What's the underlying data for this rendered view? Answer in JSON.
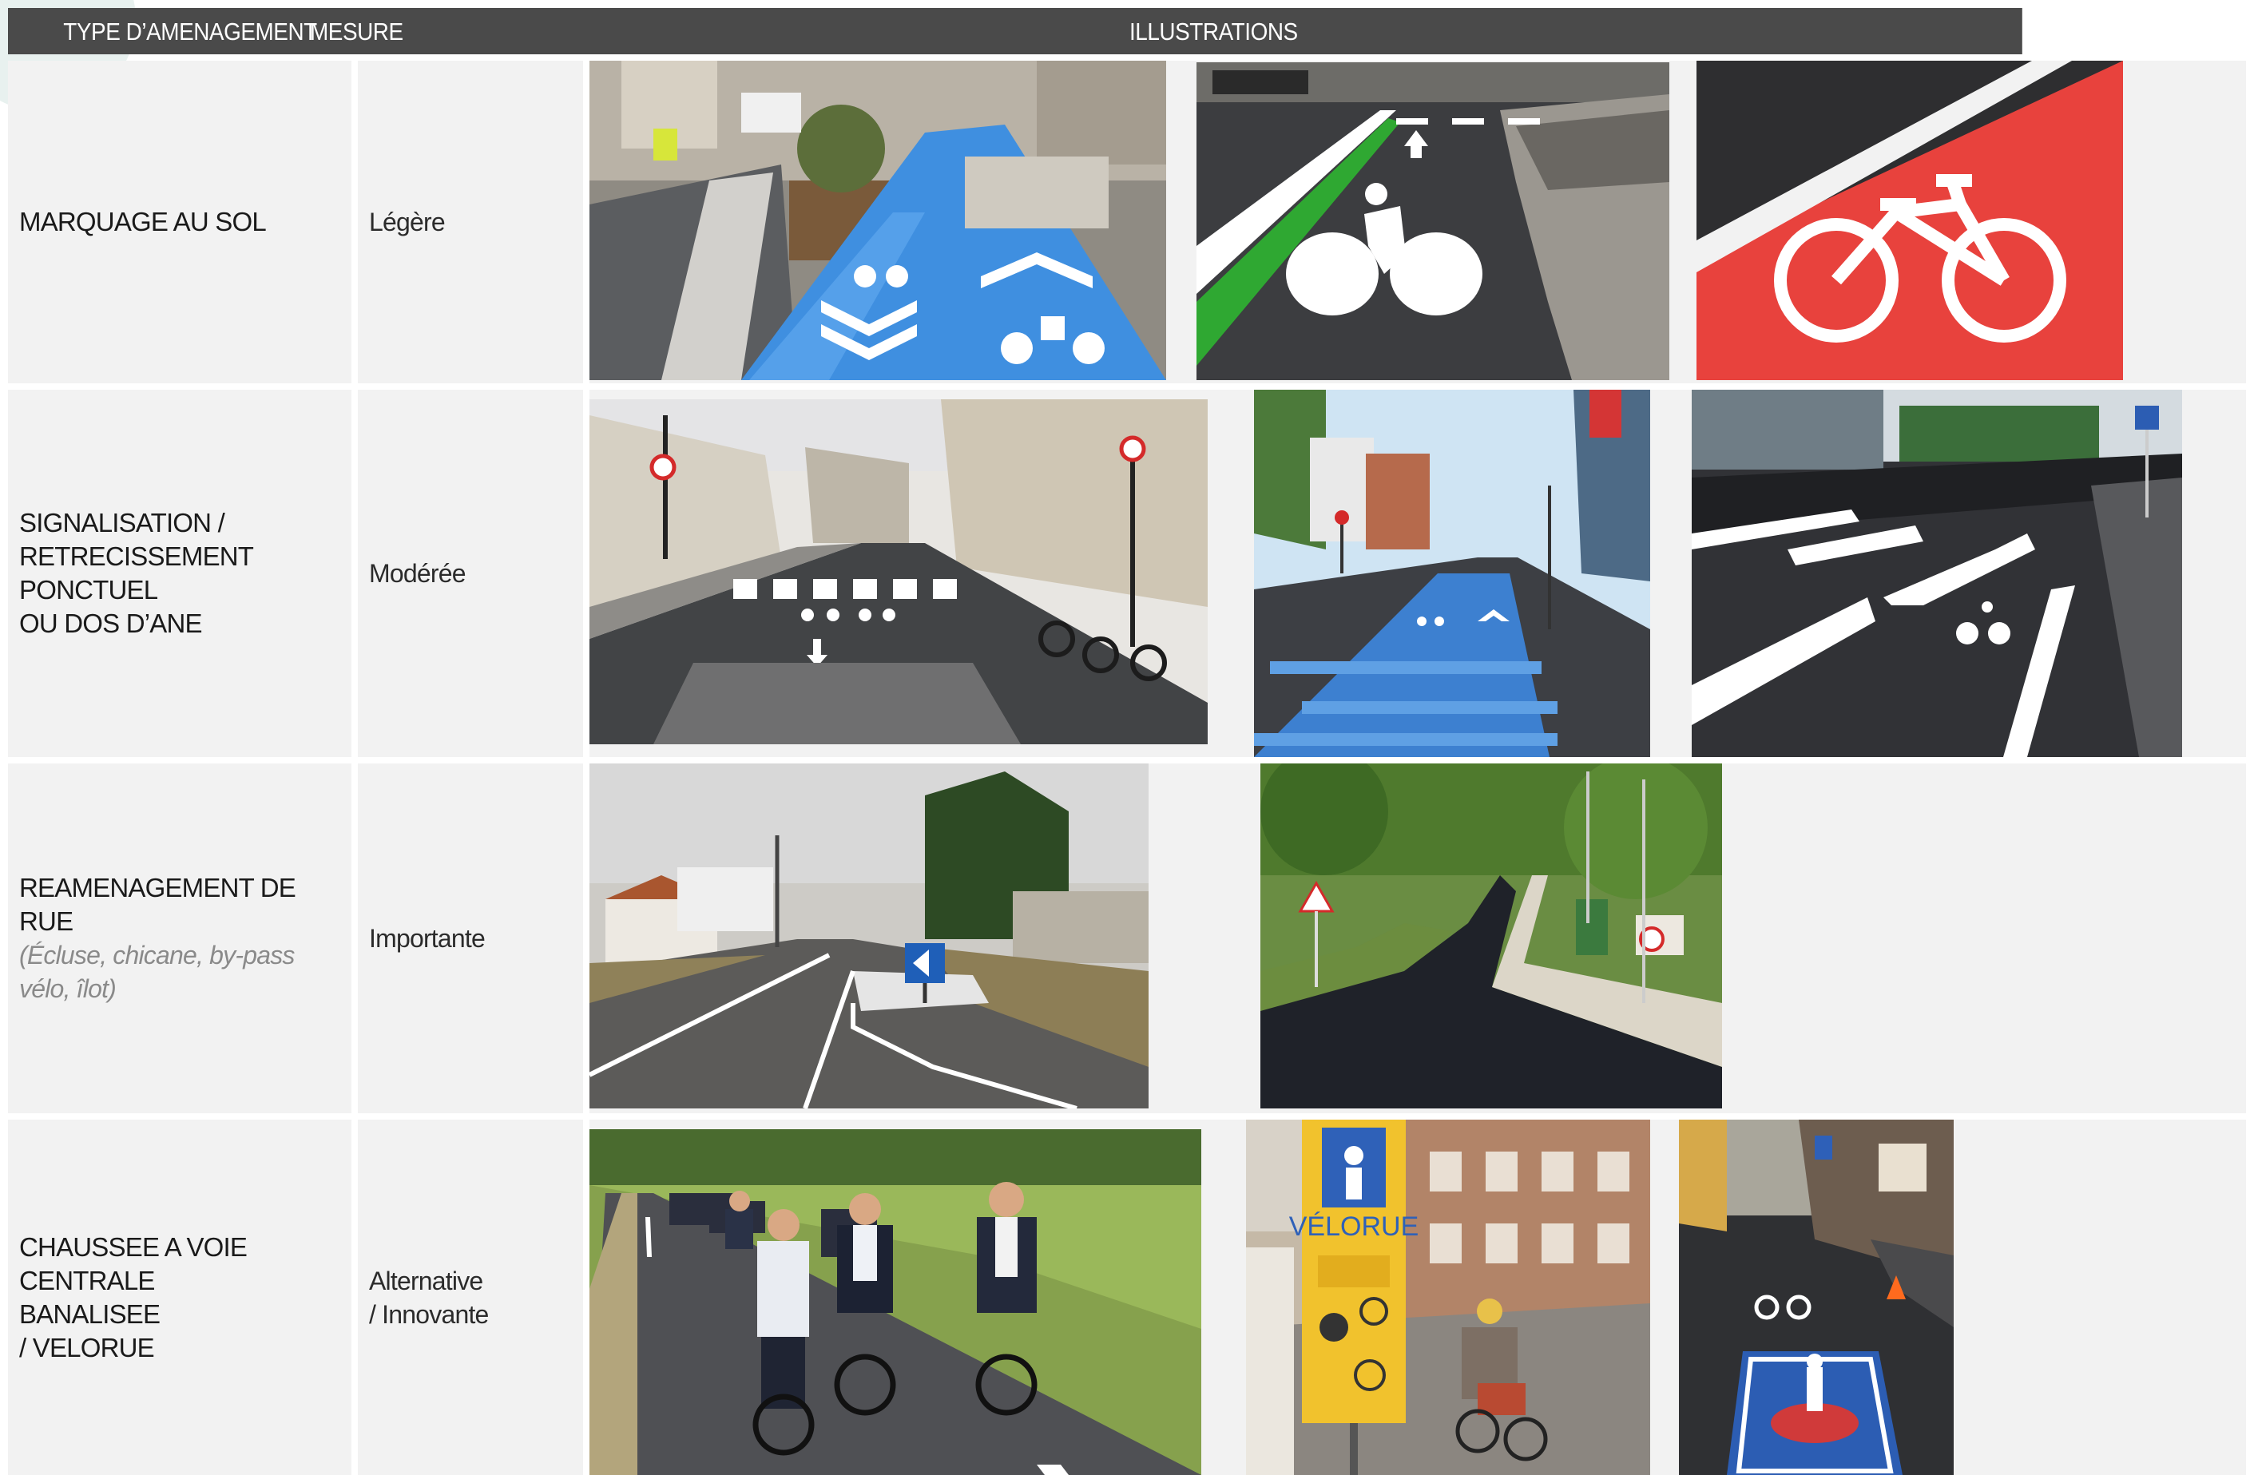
{
  "header": {
    "type_label": "TYPE D’AMENAGEMENT",
    "mesure_label": "MESURE",
    "illustrations_label": "ILLUSTRATIONS"
  },
  "rows": [
    {
      "type_lines": [
        "MARQUAGE AU SOL"
      ],
      "type_sub": "",
      "mesure_lines": [
        "Légère"
      ],
      "photos": [
        "blue-painted-bike-lane-photo",
        "green-edged-bike-lane-photo",
        "red-bike-lane-pictogram-photo"
      ]
    },
    {
      "type_lines": [
        "SIGNALISATION /",
        "RETRECISSEMENT PONCTUEL",
        "OU DOS D’ANE"
      ],
      "type_sub": "",
      "mesure_lines": [
        "Modérée"
      ],
      "photos": [
        "narrowed-street-crossing-photo",
        "blue-crossing-photo",
        "bike-bypass-island-photo"
      ]
    },
    {
      "type_lines": [
        "REAMENAGEMENT DE RUE"
      ],
      "type_sub": "(Écluse, chicane, by-pass vélo, îlot)",
      "mesure_lines": [
        "Importante"
      ],
      "photos": [
        "chicane-island-road-photo",
        "winding-new-street-photo"
      ]
    },
    {
      "type_lines": [
        "CHAUSSEE A VOIE CENTRALE",
        "BANALISEE",
        "/ VELORUE"
      ],
      "type_sub": "",
      "mesure_lines": [
        "Alternative",
        "/ Innovante"
      ],
      "photos": [
        "cyclists-on-road-photo",
        "velorue-sign-photo",
        "velorue-road-marking-photo"
      ]
    }
  ],
  "velorue_sign_text": "VÉLORUE"
}
